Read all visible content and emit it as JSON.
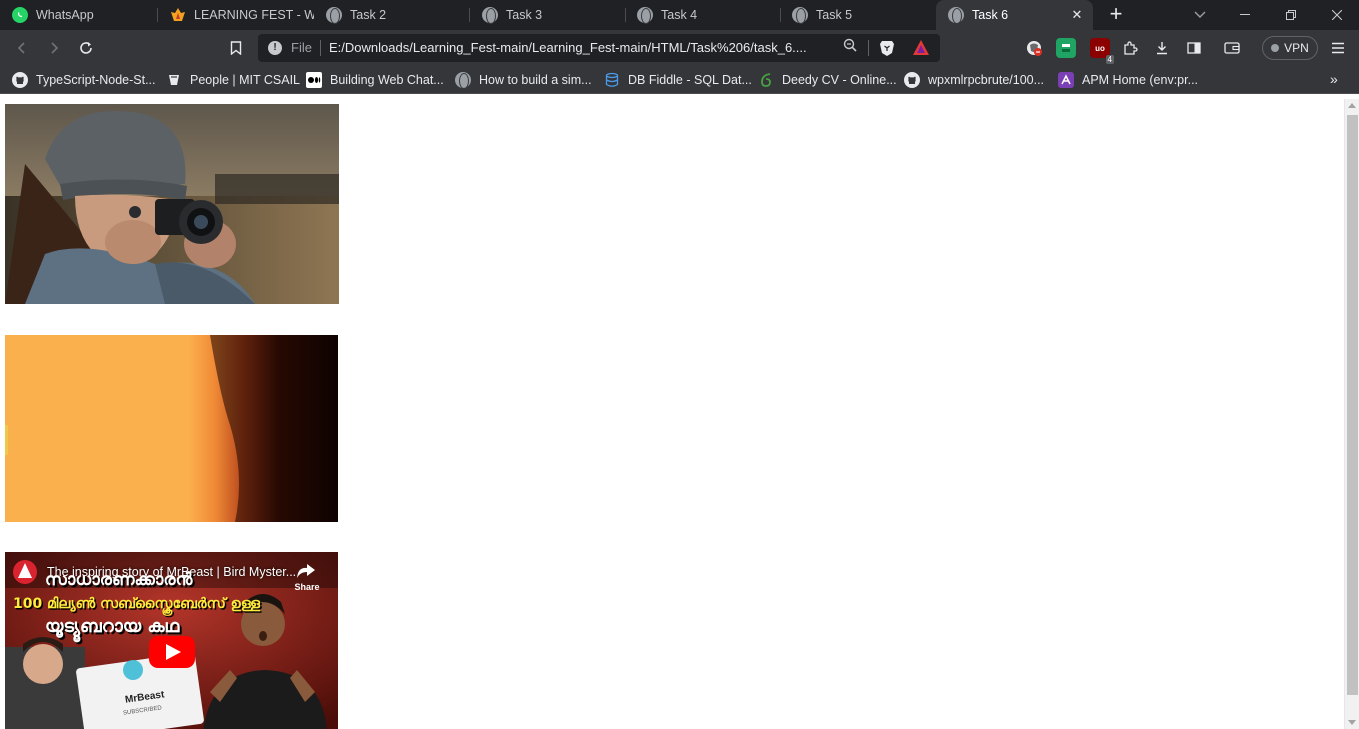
{
  "tabs": [
    {
      "label": "WhatsApp",
      "icon": "whatsapp-icon"
    },
    {
      "label": "LEARNING FEST - WEB",
      "icon": "fest-icon"
    },
    {
      "label": "Task 2",
      "icon": "globe-icon"
    },
    {
      "label": "Task 3",
      "icon": "globe-icon"
    },
    {
      "label": "Task 4",
      "icon": "globe-icon"
    },
    {
      "label": "Task 5",
      "icon": "globe-icon"
    },
    {
      "label": "Task 6",
      "icon": "globe-icon",
      "active": true
    }
  ],
  "toolbar": {
    "scheme_label": "File",
    "url": "E:/Downloads/Learning_Fest-main/Learning_Fest-main/HTML/Task%206/task_6....",
    "vpn_label": "VPN",
    "extension_badge": "4"
  },
  "bookmarks": [
    {
      "label": "TypeScript-Node-St...",
      "icon": "github-icon"
    },
    {
      "label": "People | MIT CSAIL",
      "icon": "mit-icon"
    },
    {
      "label": "Building Web Chat...",
      "icon": "medium-icon"
    },
    {
      "label": "How to build a sim...",
      "icon": "globe-icon"
    },
    {
      "label": "DB Fiddle - SQL Dat...",
      "icon": "database-icon"
    },
    {
      "label": "Deedy CV - Online...",
      "icon": "overleaf-icon"
    },
    {
      "label": "wpxmlrpcbrute/100...",
      "icon": "github-icon"
    },
    {
      "label": "APM Home (env:pr...",
      "icon": "apm-icon"
    }
  ],
  "page": {
    "video_embed": {
      "title": "The inspiring story of MrBeast | Bird Myster...",
      "share_label": "Share",
      "overlay_lines": [
        "സാധാരണക്കാരൻ",
        "100 മില്യൺ സബ്സ്ക്രൈബേർസ് ഉള്ള",
        "യൂട്യൂബറായ കഥ"
      ],
      "card_label": "MrBeast",
      "card_sub": "SUBSCRIBED"
    }
  },
  "colors": {
    "tab_strip": "#202124",
    "toolbar": "#35363a",
    "video_orange": "#fbb04e",
    "yt_red": "#ff0000"
  }
}
